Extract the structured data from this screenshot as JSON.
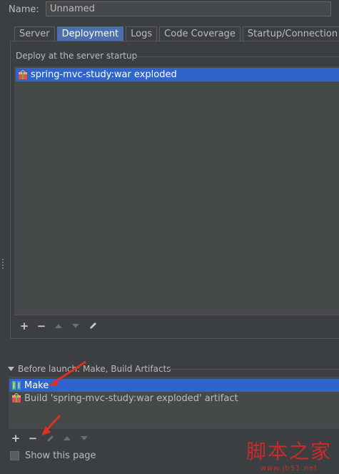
{
  "name_field": {
    "label": "Name:",
    "value": "Unnamed"
  },
  "tabs": [
    {
      "label": "Server",
      "active": false
    },
    {
      "label": "Deployment",
      "active": true
    },
    {
      "label": "Logs",
      "active": false
    },
    {
      "label": "Code Coverage",
      "active": false
    },
    {
      "label": "Startup/Connection",
      "active": false
    }
  ],
  "deploy": {
    "title": "Deploy at the server startup",
    "items": [
      {
        "label": "spring-mvc-study:war exploded",
        "icon": "artifact-icon",
        "selected": true
      }
    ],
    "toolbar": [
      "add-icon",
      "remove-icon",
      "move-up-icon",
      "move-down-icon",
      "edit-icon"
    ]
  },
  "before_launch": {
    "title": "Before launch: Make, Build Artifacts",
    "items": [
      {
        "label": "Make",
        "icon": "make-icon",
        "selected": true
      },
      {
        "label": "Build 'spring-mvc-study:war exploded' artifact",
        "icon": "artifact-icon",
        "selected": false
      }
    ],
    "toolbar": [
      "add-icon",
      "remove-icon",
      "edit-icon",
      "move-up-icon",
      "move-down-icon"
    ]
  },
  "show_page": {
    "label": "Show this page",
    "checked": false
  },
  "watermark": {
    "main": "脚本之家",
    "sub": "www.jb51.net"
  },
  "colors": {
    "background": "#3c3f41",
    "selection": "#2f65ca",
    "active_tab": "#4b6eaf",
    "annotation_arrow": "#e0301e"
  }
}
